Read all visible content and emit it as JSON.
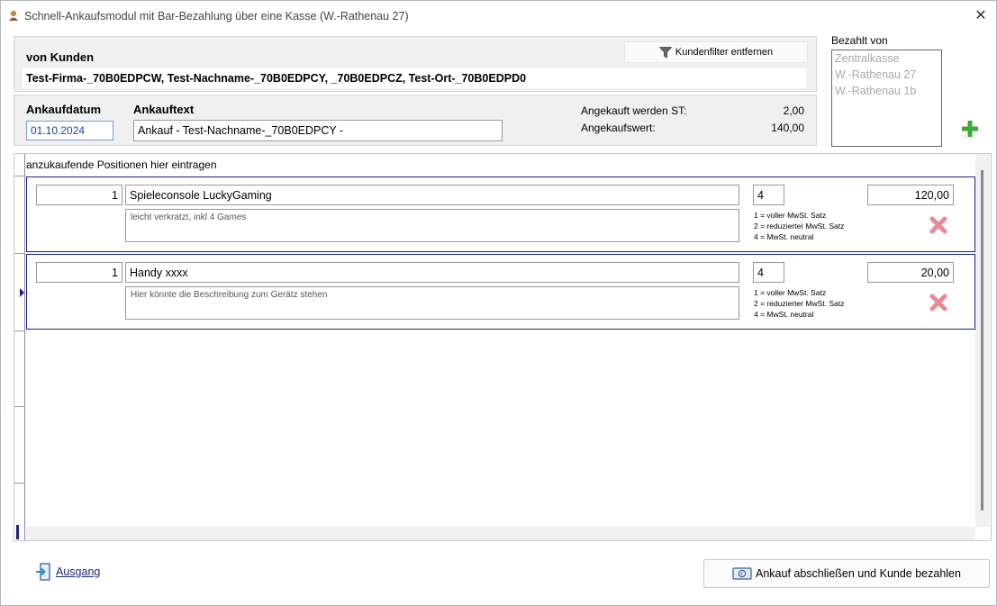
{
  "window": {
    "title": "Schnell-Ankaufsmodul mit Bar-Bezahlung über eine Kasse (W.-Rathenau 27)"
  },
  "customer": {
    "label": "von Kunden",
    "filter_button": "Kundenfilter entfernen",
    "name": "Test-Firma-_70B0EDPCW, Test-Nachname-_70B0EDPCY, _70B0EDPCZ, Test-Ort-_70B0EDPD0"
  },
  "purchase": {
    "date_label": "Ankaufdatum",
    "date_value": "01.10.2024",
    "text_label": "Ankauftext",
    "text_value": "Ankauf - Test-Nachname-_70B0EDPCY -",
    "count_label": "Angekauft werden ST:",
    "count_value": "2,00",
    "value_label": "Angekaufswert:",
    "value_value": "140,00"
  },
  "payment": {
    "label": "Bezahlt von",
    "options": [
      "Zentralkasse",
      "W.-Rathenau 27",
      "W.-Rathenau 1b"
    ]
  },
  "positions": {
    "header": "anzukaufende Positionen hier eintragen",
    "mwst_legend": [
      "1 = voller MwSt. Satz",
      "2 = reduzierter MwSt. Satz",
      "4 = MwSt. neutral"
    ],
    "items": [
      {
        "qty": "1",
        "name": "Spieleconsole LuckyGaming",
        "description": "leicht verkratzt, inkl 4 Games",
        "tax_code": "4",
        "price": "120,00"
      },
      {
        "qty": "1",
        "name": "Handy xxxx",
        "description": "Hier könnte die Beschreibung zum Gerätz stehen",
        "tax_code": "4",
        "price": "20,00"
      }
    ]
  },
  "footer": {
    "exit_label": "Ausgang",
    "pay_label": "Ankauf abschließen und Kunde bezahlen"
  },
  "colors": {
    "accent_navy": "#1a237e",
    "delete_red": "#e88a93",
    "add_green": "#3aa935"
  }
}
